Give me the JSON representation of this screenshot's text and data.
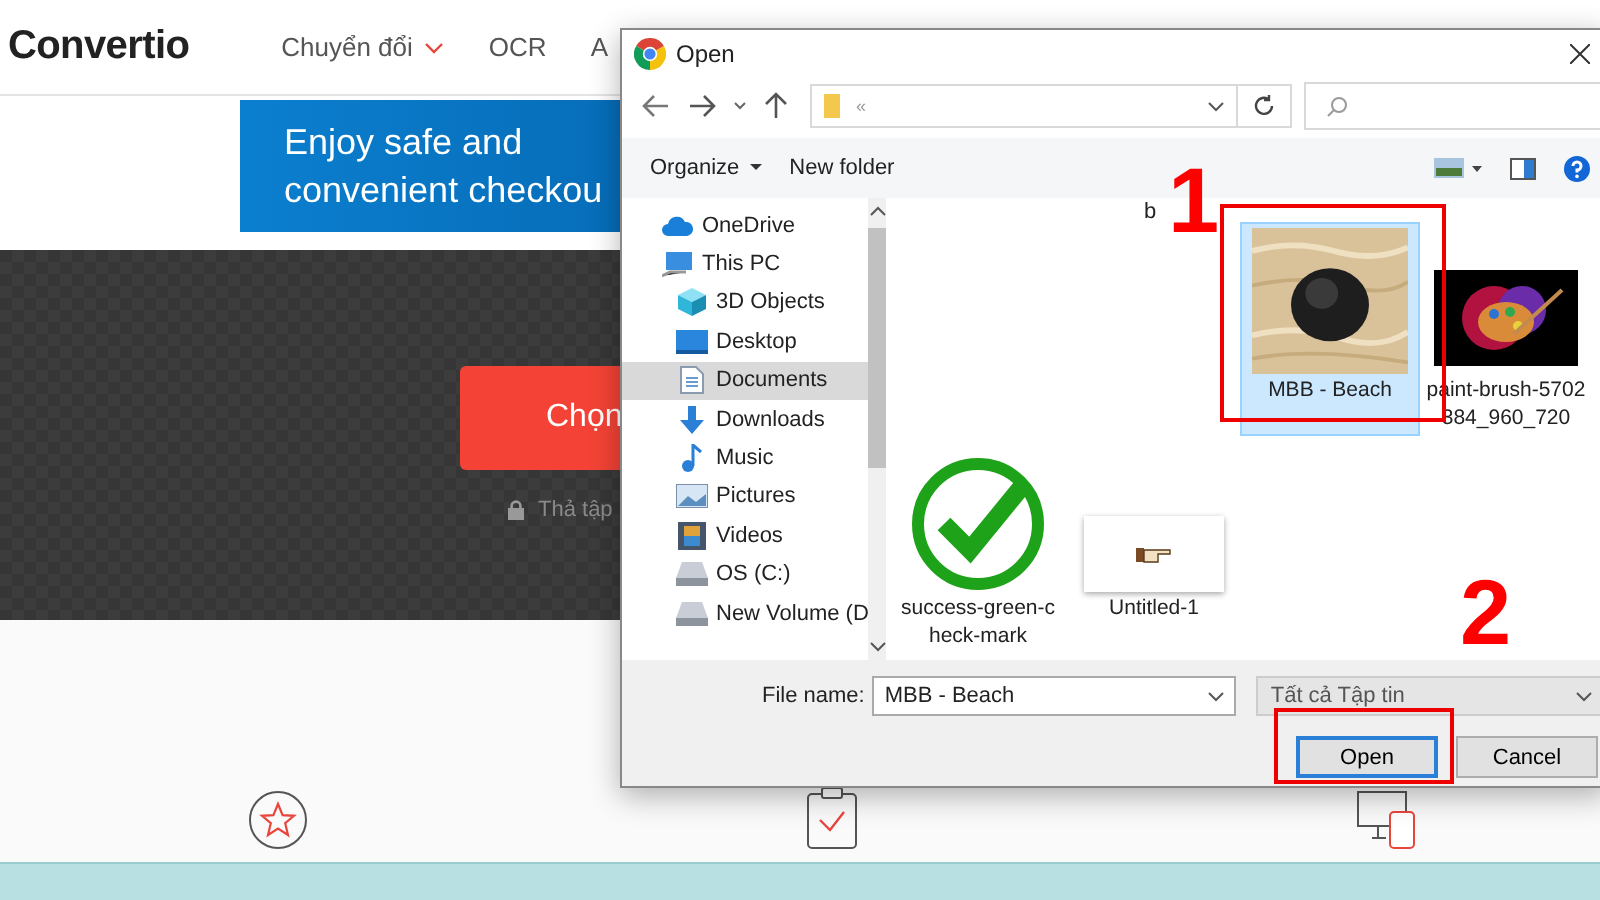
{
  "page": {
    "logo": "Convertio",
    "nav": [
      {
        "label": "Chuyển đổi",
        "dropdown": true
      },
      {
        "label": "OCR",
        "dropdown": false
      },
      {
        "label": "A",
        "dropdown": false
      }
    ],
    "banner": [
      "Enjoy safe and",
      "convenient checkou"
    ],
    "choose_button": "Chọn",
    "drop_hint": "Thả tập",
    "features": [
      {
        "kind": "star"
      },
      {
        "kind": "clipboard"
      },
      {
        "kind": "devices"
      }
    ]
  },
  "dialog": {
    "title": "Open",
    "address": "«",
    "toolbar": {
      "organize": "Organize",
      "new_folder": "New folder"
    },
    "sidebar": [
      {
        "label": "OneDrive",
        "kind": "cloud",
        "selected": false
      },
      {
        "label": "This PC",
        "kind": "pc",
        "selected": false,
        "children": [
          {
            "label": "3D Objects",
            "kind": "cube",
            "selected": false
          },
          {
            "label": "Desktop",
            "kind": "desktop",
            "selected": false
          },
          {
            "label": "Documents",
            "kind": "document",
            "selected": true
          },
          {
            "label": "Downloads",
            "kind": "download",
            "selected": false
          },
          {
            "label": "Music",
            "kind": "music",
            "selected": false
          },
          {
            "label": "Pictures",
            "kind": "pictures",
            "selected": false
          },
          {
            "label": "Videos",
            "kind": "videos",
            "selected": false
          },
          {
            "label": "OS (C:)",
            "kind": "drive",
            "selected": false
          },
          {
            "label": "New Volume (D",
            "kind": "drive",
            "selected": false
          }
        ]
      }
    ],
    "cut_label": "b",
    "files": [
      {
        "name": "MBB - Beach",
        "kind": "beach",
        "selected": true
      },
      {
        "name": "paint-brush-5702384_960_720",
        "kind": "palette",
        "selected": false
      },
      {
        "name": "success-green-check-mark",
        "kind": "check",
        "selected": false
      },
      {
        "name": "Untitled-1",
        "kind": "hand",
        "selected": false
      }
    ],
    "file_name_label": "File name:",
    "file_name": "MBB - Beach",
    "file_type": "Tất cả Tập tin",
    "buttons": [
      {
        "label": "Open",
        "kind": "primary"
      },
      {
        "label": "Cancel",
        "kind": "normal"
      }
    ]
  },
  "annotations": [
    "1",
    "2"
  ]
}
